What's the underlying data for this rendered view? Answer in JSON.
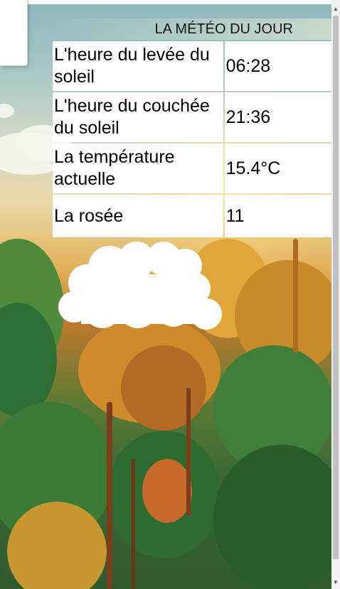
{
  "weather": {
    "title": "LA MÉTÉO DU JOUR",
    "rows": [
      {
        "label": "L'heure du levée du soleil",
        "value": "06:28"
      },
      {
        "label": "L'heure du couchée du soleil",
        "value": "21:36"
      },
      {
        "label": "La température actuelle",
        "value": "15.4°C"
      },
      {
        "label": "La rosée",
        "value": "11"
      }
    ],
    "icon": "cloud-icon"
  },
  "scrollbar": {
    "up_glyph": "▲",
    "down_glyph": "▼"
  }
}
